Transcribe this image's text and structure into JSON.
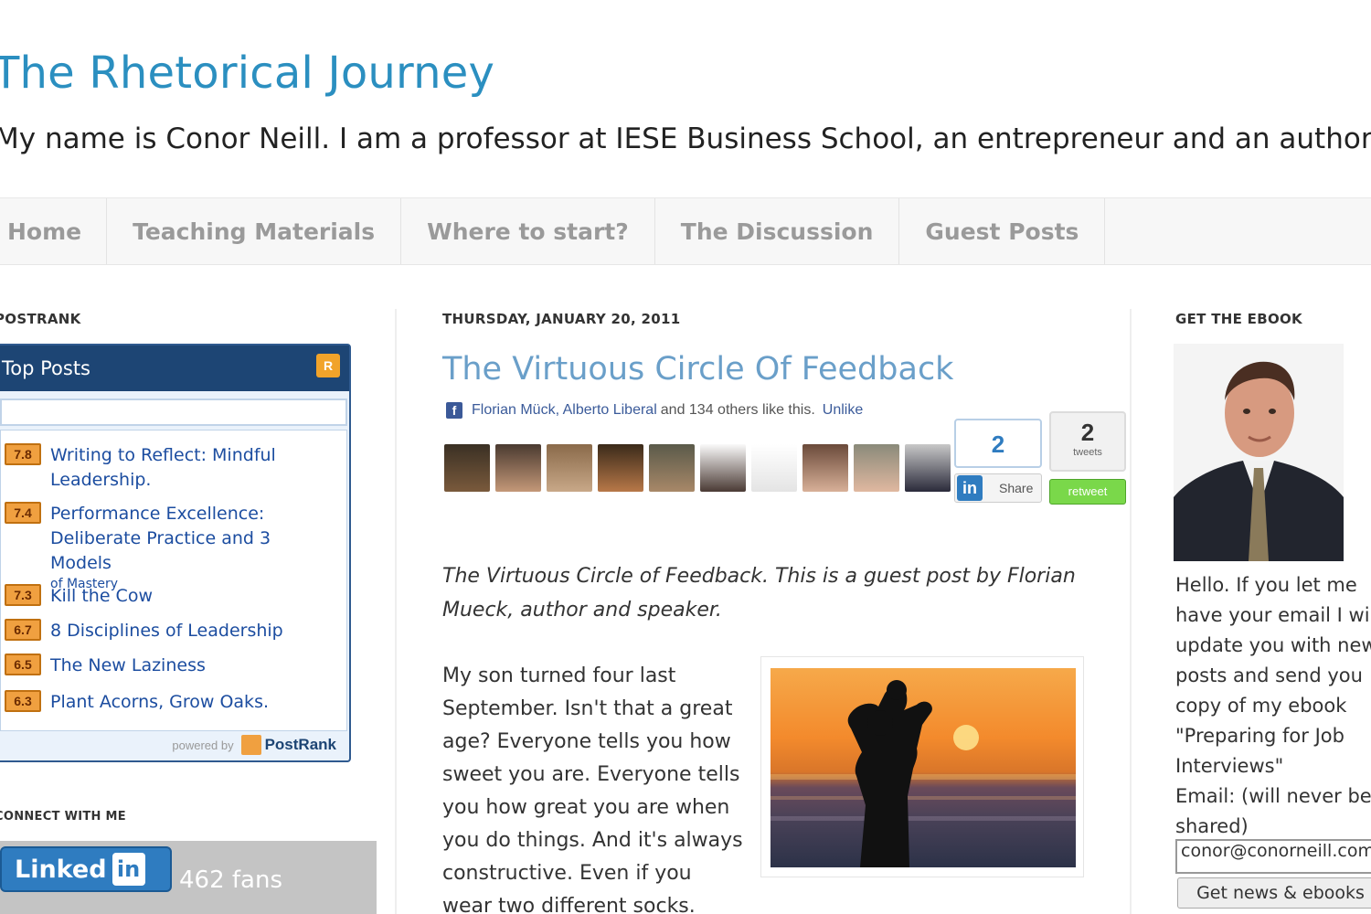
{
  "header": {
    "title": "The Rhetorical Journey",
    "description": "My name is Conor Neill. I am a professor at IESE Business School, an entrepreneur and an author."
  },
  "nav": {
    "tabs": [
      {
        "label": "Home"
      },
      {
        "label": "Teaching Materials"
      },
      {
        "label": "Where to start?"
      },
      {
        "label": "The Discussion"
      },
      {
        "label": "Guest Posts"
      }
    ]
  },
  "left_sidebar": {
    "postrank_heading": "POSTRANK",
    "widget_title": "Top Posts",
    "rss_icon": "rss-icon",
    "top_posts": [
      {
        "score": "7.8",
        "title": "Writing to Reflect: Mindful Leadership."
      },
      {
        "score": "7.4",
        "title": "Performance Excellence: Deliberate Practice and 3 Models",
        "subtitle": "of Mastery"
      },
      {
        "score": "7.3",
        "title": "Kill the Cow"
      },
      {
        "score": "6.7",
        "title": "8 Disciplines of Leadership"
      },
      {
        "score": "6.5",
        "title": "The New Laziness"
      },
      {
        "score": "6.3",
        "title": "Plant Acorns, Grow Oaks."
      }
    ],
    "powered_by": "powered by",
    "powered_brand": "PostRank",
    "connect_heading": "CONNECT WITH ME",
    "linkedin_label": "Linked",
    "linkedin_badge": "in",
    "fans": "462 fans"
  },
  "post": {
    "date": "THURSDAY, JANUARY 20, 2011",
    "title": "The Virtuous Circle Of Feedback",
    "fb_names": "Florian Mück, Alberto Liberal",
    "fb_rest": "and 134 others like this.",
    "fb_unlike": "Unlike",
    "linkedin_count": "2",
    "linkedin_share": "Share",
    "tweet_count": "2",
    "tweet_label": "tweets",
    "tweet_button": "retweet",
    "intro": "The Virtuous Circle of Feedback. This is a guest post by Florian Mueck, author and speaker.",
    "body": "My son turned four last September. Isn't that a great age? Everyone tells you how sweet you are. Everyone tells you how great you are when you do things. And it's always constructive. Even if you wear two different socks."
  },
  "right_sidebar": {
    "heading": "GET THE EBOOK",
    "text": "Hello. If you let me have your email I will update you with new posts and send you copy of my ebook \"Preparing for Job Interviews\"",
    "email_label": "Email: (will never be shared)",
    "email_value": "conor@conorneill.com",
    "button": "Get news & ebooks"
  },
  "colors": {
    "title_blue": "#2b8fc0",
    "post_title": "#6a9fc9",
    "postrank_header": "#1d4574",
    "score_orange": "#f0a040",
    "linkedin_blue": "#2f7cc0",
    "tweet_green": "#7ad84a"
  }
}
